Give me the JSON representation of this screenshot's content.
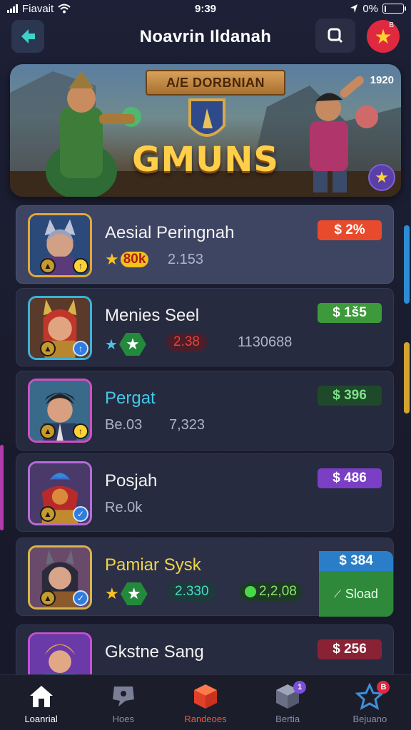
{
  "status_bar": {
    "carrier": "Fiavait",
    "time": "9:39",
    "battery": "0%"
  },
  "header": {
    "title": "Noavrin Ildanah",
    "fav_badge": "B"
  },
  "banner": {
    "ribbon": "A/E DORBNIAN",
    "title": "GMUNS",
    "count": "1920"
  },
  "items": [
    {
      "name": "Aesial Peringnah",
      "price": "$ 2%",
      "price_color": "#e84b2c",
      "stat1": "80k",
      "stat2": "2.153"
    },
    {
      "name": "Menies Seel",
      "price": "$ 1š5",
      "price_color": "#3d9a3a",
      "stat1": "2.38",
      "stat2": "1130688"
    },
    {
      "name": "Pergat",
      "price": "$ 396",
      "price_color": "#2c6a3a",
      "stat1": "Be.03",
      "stat2": "7,323"
    },
    {
      "name": "Posjah",
      "price": "$ 486",
      "price_color": "#7b3fc6",
      "stat1": "Re.0k"
    },
    {
      "name": "Pamiar Sysk",
      "price": "$ 384",
      "price_color": "#2a7ec8",
      "stat1": "2.330",
      "stat2": "2,2,08",
      "buy_label": "Sload"
    },
    {
      "name": "Gkstne Sang",
      "price": "$ 256",
      "price_color": "#8a2235"
    }
  ],
  "nav": [
    {
      "label": "Loanrial",
      "icon": "home-icon"
    },
    {
      "label": "Hoes",
      "icon": "chat-icon"
    },
    {
      "label": "Randeoes",
      "icon": "store-icon"
    },
    {
      "label": "Bertia",
      "icon": "box-icon",
      "badge": "1"
    },
    {
      "label": "Bejuano",
      "icon": "star-outline-icon",
      "badge": "B"
    }
  ]
}
